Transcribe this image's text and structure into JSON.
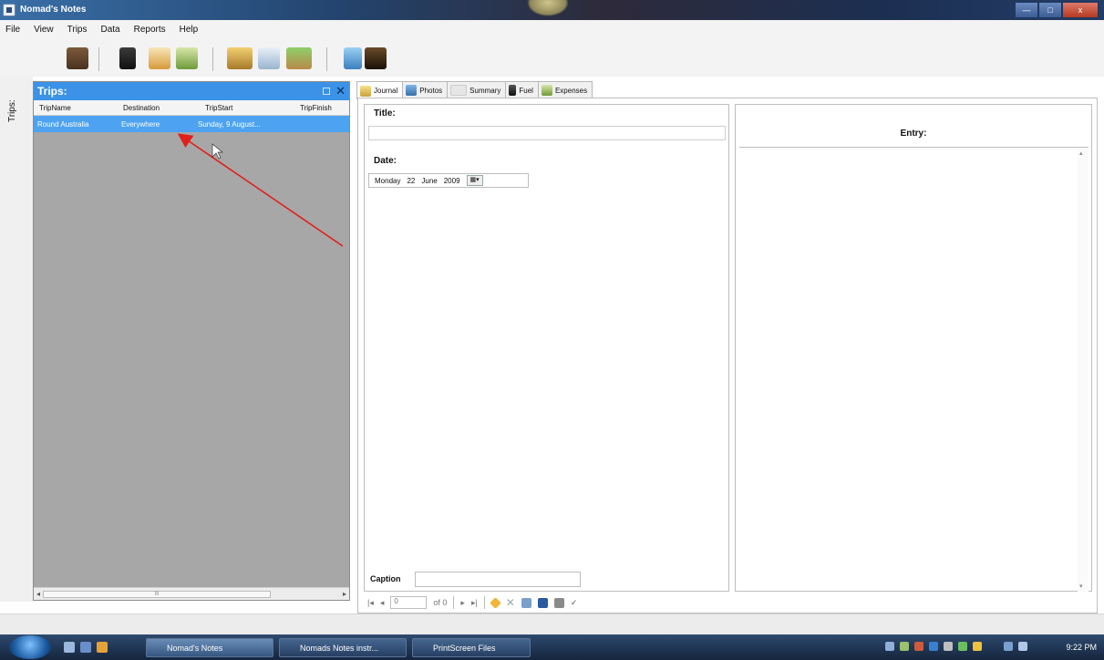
{
  "window": {
    "title": "Nomad's Notes",
    "buttons": {
      "minimize": "—",
      "maximize": "□",
      "close": "x"
    }
  },
  "menu": [
    "File",
    "View",
    "Trips",
    "Data",
    "Reports",
    "Help"
  ],
  "toolbar_icons": [
    "trip-case-icon",
    "fuel-pump-icon",
    "house-icon",
    "expenses-icon",
    "vehicle-icon",
    "map-icon",
    "island-icon",
    "signpost-icon",
    "camera-icon"
  ],
  "side_strip": {
    "label": "Trips:"
  },
  "trips": {
    "header": "Trips:",
    "columns": [
      "TripName",
      "Destination",
      "TripStart",
      "TripFinish"
    ],
    "rows": [
      {
        "TripName": "Round Australia",
        "Destination": "Everywhere",
        "TripStart": "Sunday, 9 August...",
        "TripFinish": ""
      }
    ],
    "scroll_thumb_label": "III"
  },
  "tabs": [
    {
      "label": "Journal",
      "icon": "journal-icon",
      "active": true
    },
    {
      "label": "Photos",
      "icon": "photos-icon",
      "active": false
    },
    {
      "label": "Summary",
      "icon": "summary-icon",
      "active": false
    },
    {
      "label": "Fuel",
      "icon": "fuel-icon",
      "active": false
    },
    {
      "label": "Expenses",
      "icon": "expenses-icon",
      "active": false
    }
  ],
  "journal": {
    "title_label": "Title:",
    "title_value": "",
    "date_label": "Date:",
    "date": {
      "weekday": "Monday",
      "day": "22",
      "month": "June",
      "year": "2009"
    },
    "caption_label": "Caption",
    "caption_value": "",
    "entry_label": "Entry:"
  },
  "navigator": {
    "position": "0",
    "of_text": "of 0"
  },
  "taskbar": {
    "tasks": [
      {
        "label": "Nomad's Notes",
        "active": true
      },
      {
        "label": "Nomads Notes instr...",
        "active": false
      },
      {
        "label": "PrintScreen Files",
        "active": false
      }
    ],
    "clock": "9:22 PM"
  },
  "colors": {
    "selection": "#4da3f1",
    "panel_header": "#3b92e6",
    "arrow": "#e0201a"
  }
}
